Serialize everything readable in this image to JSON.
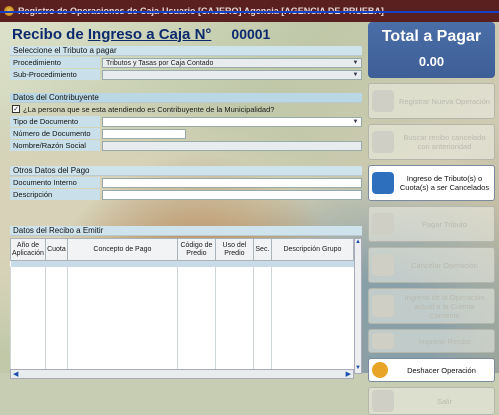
{
  "window": {
    "title": "Registro de Operaciones de Caja-Usuario [CAJERO] Agencia [AGENCIA DE PRUEBA]"
  },
  "header": {
    "title_left": "Recibo de ",
    "title_underlined": "Ingreso a Caja N°",
    "receipt_number": "00001"
  },
  "tributo": {
    "section_label": "Seleccione el Tributo a pagar",
    "procedimiento_label": "Procedimiento",
    "procedimiento_value": "Tributos y Tasas por Caja Contado",
    "subprocedimiento_label": "Sub-Procedimiento",
    "subprocedimiento_value": ""
  },
  "contribuyente": {
    "section_label": "Datos del Contribuyente",
    "question": "¿La persona que se esta atendiendo es Contribuyente de la Municipalidad?",
    "checked": "✓",
    "tipo_doc_label": "Tipo de Documento",
    "num_doc_label": "Número de Documento",
    "nombre_label": "Nombre/Razón Social"
  },
  "pago": {
    "section_label": "Otros Datos del Pago",
    "doc_interno_label": "Documento Interno",
    "descripcion_label": "Descripción"
  },
  "recibo": {
    "section_label": "Datos del Recibo a Emitir",
    "columns": [
      "Año de Aplicación",
      "Cuota",
      "Concepto de Pago",
      "Código de Predio",
      "Uso del Predio",
      "Sec.",
      "Descripción Grupo"
    ]
  },
  "total": {
    "label": "Total a Pagar",
    "value": "0.00"
  },
  "actions": [
    {
      "label": "Registrar Nueva Operación",
      "enabled": false
    },
    {
      "label": "Buscar recibo cancelado con anterioridad",
      "enabled": false
    },
    {
      "label": "Ingreso de Tributo(s) o Cuota(s) a ser Cancelados",
      "enabled": true
    },
    {
      "label": "Pagar Tributo",
      "enabled": false
    },
    {
      "label": "Cancelar Operación",
      "enabled": false
    },
    {
      "label": "Ingreso de la Operación actual a la Cuenta Corriente",
      "enabled": false
    },
    {
      "label": "Imprimir Recibo",
      "enabled": false
    },
    {
      "label": "Deshacer Operación",
      "enabled": true
    },
    {
      "label": "Salir",
      "enabled": false
    }
  ]
}
